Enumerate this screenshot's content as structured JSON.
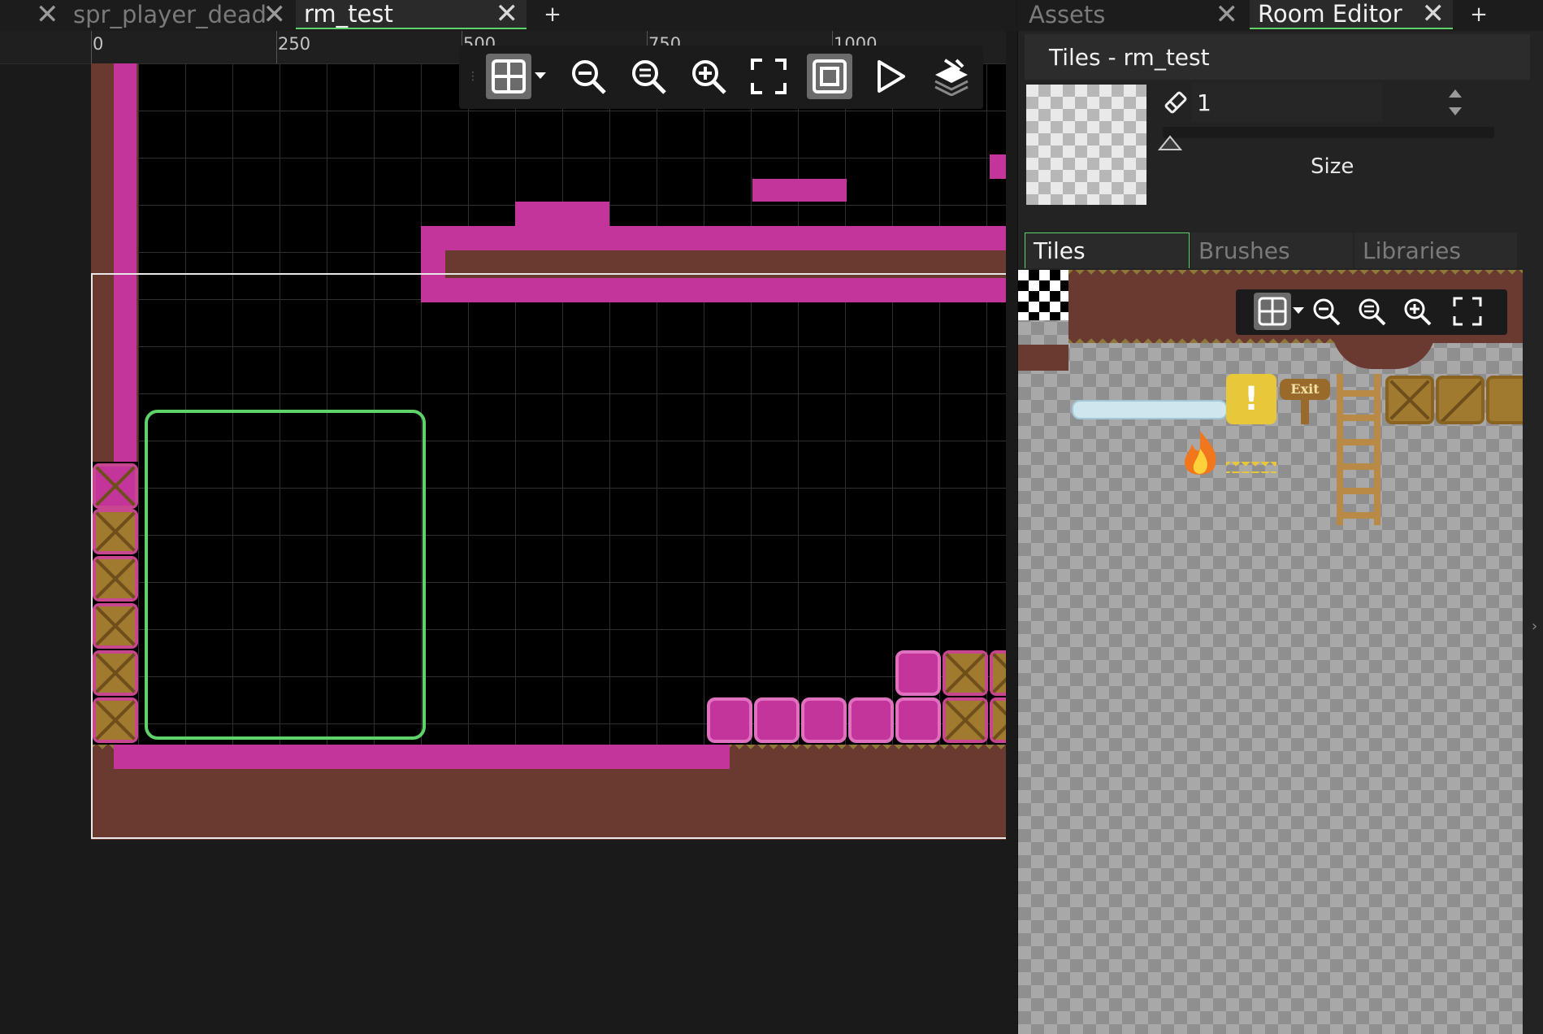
{
  "tabs": {
    "left": [
      {
        "label": "",
        "close": "✕"
      },
      {
        "label": "spr_player_dead",
        "close": "✕"
      },
      {
        "label": "rm_test",
        "close": "✕"
      }
    ],
    "add": "+"
  },
  "ruler": {
    "ticks": [
      "0",
      "250",
      "500",
      "750",
      "1000"
    ]
  },
  "room_toolbar": {
    "buttons": [
      "grid-toggle",
      "zoom-out",
      "zoom-reset",
      "zoom-in",
      "fit-view",
      "toggle-frame",
      "play",
      "layers"
    ]
  },
  "panel": {
    "tabs": [
      {
        "label": "Assets",
        "close": "✕"
      },
      {
        "label": "Room Editor",
        "close": "✕"
      }
    ],
    "add": "+",
    "title": "Tiles - rm_test",
    "brush_size_value": "1",
    "size_label": "Size",
    "subtabs": [
      "Tiles",
      "Brushes",
      "Libraries"
    ],
    "tileset_labels": {
      "exit_sign": "Exit",
      "alert": "!"
    }
  },
  "colors": {
    "accent_green": "#5ed36a",
    "highlight_magenta": "#c3359a",
    "dirt": "#6a3a30"
  }
}
